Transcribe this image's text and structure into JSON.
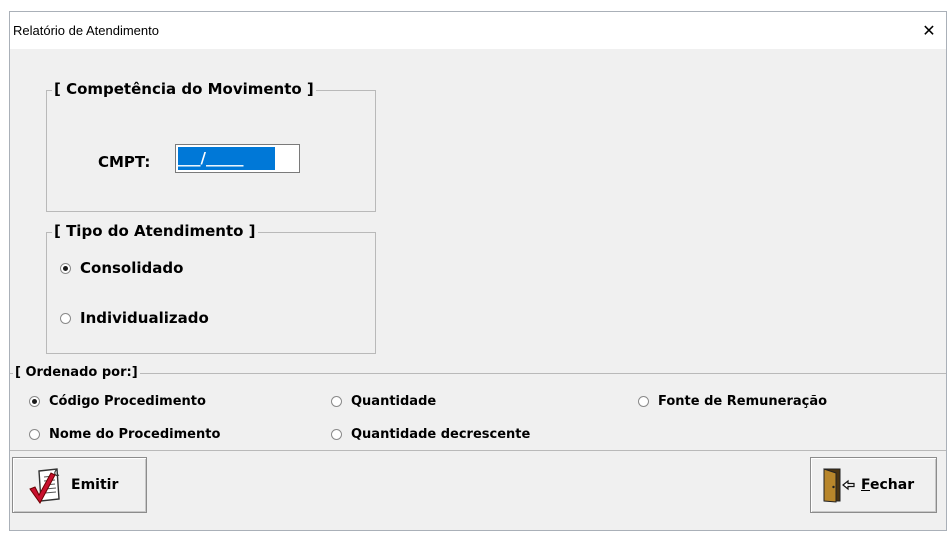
{
  "window": {
    "title": "Relatório de Atendimento",
    "close_symbol": "✕"
  },
  "competencia": {
    "legend": "[ Competência do Movimento ]",
    "label": "CMPT:",
    "value": "___/_____"
  },
  "tipo": {
    "legend": "[ Tipo do Atendimento ]",
    "options": [
      {
        "label": "Consolidado",
        "selected": true
      },
      {
        "label": "Individualizado",
        "selected": false
      }
    ]
  },
  "ordenado": {
    "legend": "[ Ordenado por:]",
    "options": [
      {
        "label": "Código Procedimento",
        "selected": true
      },
      {
        "label": "Quantidade",
        "selected": false
      },
      {
        "label": "Fonte de Remuneração",
        "selected": false
      },
      {
        "label": "Nome do Procedimento",
        "selected": false
      },
      {
        "label": "Quantidade decrescente",
        "selected": false
      }
    ]
  },
  "buttons": {
    "emitir": {
      "label": "Emitir",
      "icon": "report-checkmark-icon"
    },
    "fechar": {
      "hotkey": "F",
      "label_rest": "echar",
      "icon": "exit-door-icon"
    }
  },
  "colors": {
    "selection": "#0078d7",
    "window_bg": "#f0f0f0",
    "checkmark": "#c8102e"
  }
}
